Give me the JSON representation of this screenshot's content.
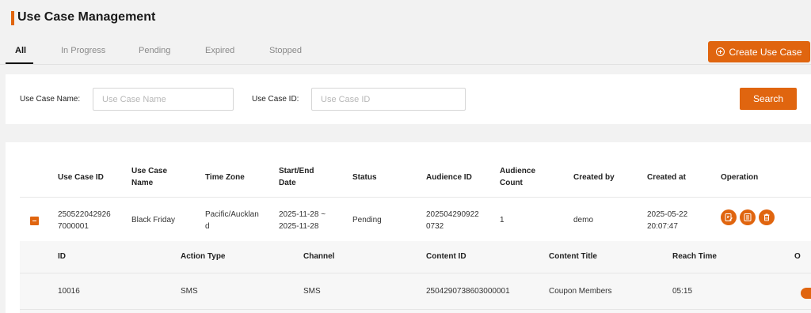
{
  "header": {
    "title": "Use Case Management"
  },
  "tabs": [
    {
      "label": "All",
      "active": true
    },
    {
      "label": "In Progress",
      "active": false
    },
    {
      "label": "Pending",
      "active": false
    },
    {
      "label": "Expired",
      "active": false
    },
    {
      "label": "Stopped",
      "active": false
    }
  ],
  "toolbar": {
    "create_label": "Create Use Case",
    "create_icon": "plus-circle-icon"
  },
  "search": {
    "name_label": "Use Case Name:",
    "name_placeholder": "Use Case Name",
    "name_value": "",
    "id_label": "Use Case ID:",
    "id_placeholder": "Use Case ID",
    "id_value": "",
    "search_label": "Search"
  },
  "table": {
    "columns": [
      {
        "line1": "Use Case ID",
        "line2": ""
      },
      {
        "line1": "Use Case",
        "line2": "Name"
      },
      {
        "line1": "Time Zone",
        "line2": ""
      },
      {
        "line1": "Start/End",
        "line2": "Date"
      },
      {
        "line1": "Status",
        "line2": ""
      },
      {
        "line1": "Audience ID",
        "line2": ""
      },
      {
        "line1": "Audience",
        "line2": "Count"
      },
      {
        "line1": "Created by",
        "line2": ""
      },
      {
        "line1": "Created at",
        "line2": ""
      },
      {
        "line1": "Operation",
        "line2": ""
      }
    ],
    "rows": [
      {
        "expanded": true,
        "id_line1": "250522042926",
        "id_line2": "7000001",
        "name": "Black Friday",
        "tz_line1": "Pacific/Aucklan",
        "tz_line2": "d",
        "date_line1": "2025-11-28 ~",
        "date_line2": "2025-11-28",
        "status": "Pending",
        "audience_id_line1": "202504290922",
        "audience_id_line2": "0732",
        "audience_count": "1",
        "created_by": "demo",
        "created_at_line1": "2025-05-22",
        "created_at_line2": "20:07:47",
        "operations": [
          "edit-icon",
          "detail-icon",
          "delete-icon"
        ]
      }
    ],
    "sub_table": {
      "columns": [
        "ID",
        "Action Type",
        "Channel",
        "Content ID",
        "Content Title",
        "Reach Time",
        "O"
      ],
      "rows": [
        {
          "id": "10016",
          "action_type": "SMS",
          "channel": "SMS",
          "content_id": "2504290738603000001",
          "content_title": "Coupon Members",
          "reach_time": "05:15"
        }
      ]
    }
  },
  "colors": {
    "accent": "#e0650f",
    "background": "#f2f2f2",
    "panel": "#ffffff",
    "subtable": "#f7f7f7"
  }
}
